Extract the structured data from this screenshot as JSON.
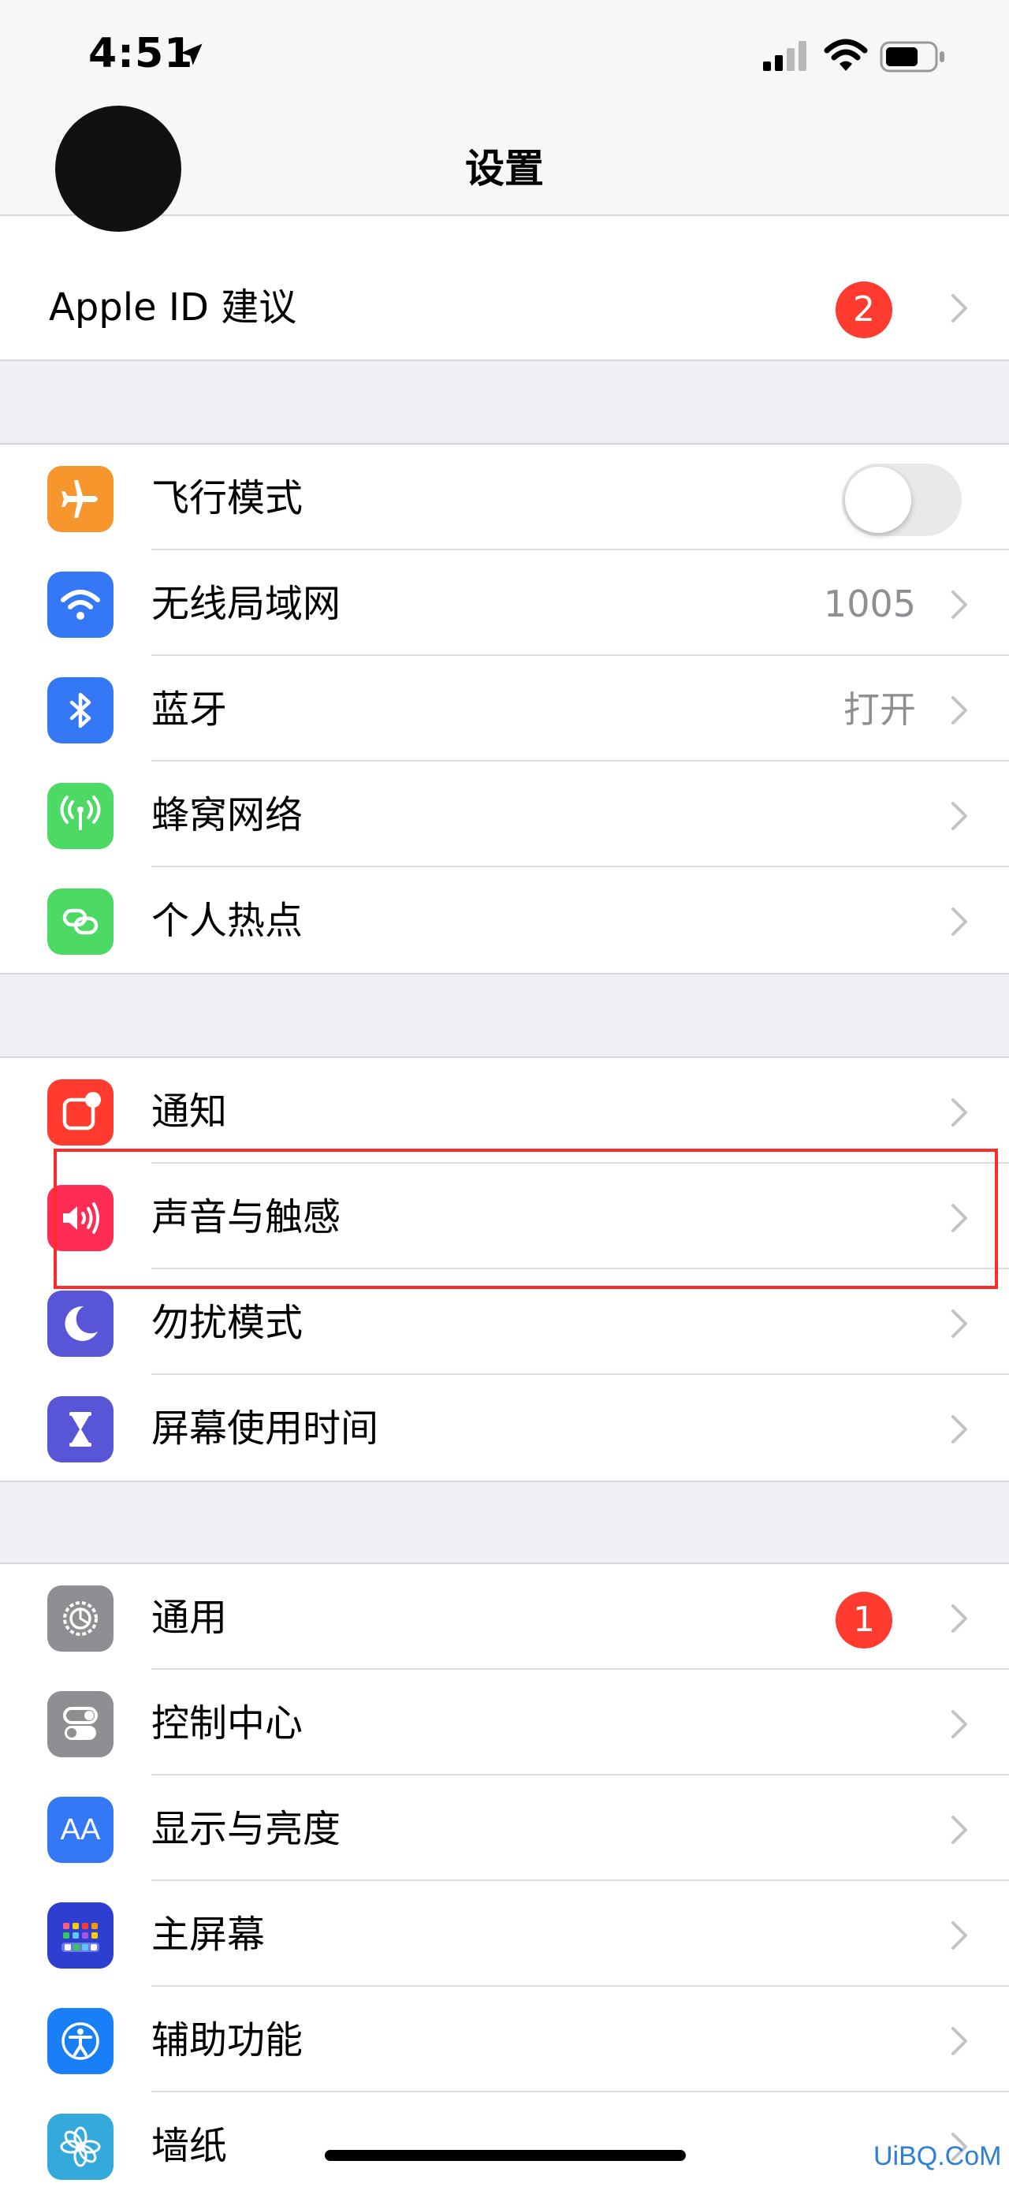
{
  "status_bar": {
    "time": "4:51"
  },
  "nav": {
    "title": "设置"
  },
  "apple_id": {
    "label": "Apple ID 建议",
    "badge": "2"
  },
  "connectivity": [
    {
      "label": "飞行模式",
      "icon": "airplane-icon",
      "color": "#f7962c",
      "toggle_on": false
    },
    {
      "label": "无线局域网",
      "icon": "wifi-icon",
      "color": "#3478f6",
      "value": "1005"
    },
    {
      "label": "蓝牙",
      "icon": "bluetooth-icon",
      "color": "#3478f6",
      "value": "打开"
    },
    {
      "label": "蜂窝网络",
      "icon": "cellular-icon",
      "color": "#4cd964"
    },
    {
      "label": "个人热点",
      "icon": "hotspot-icon",
      "color": "#4cd964"
    }
  ],
  "notifications": [
    {
      "label": "通知",
      "icon": "notifications-icon",
      "color": "#ff3b30"
    },
    {
      "label": "声音与触感",
      "icon": "speaker-icon",
      "color": "#ff2d55"
    },
    {
      "label": "勿扰模式",
      "icon": "moon-icon",
      "color": "#5856d6"
    },
    {
      "label": "屏幕使用时间",
      "icon": "hourglass-icon",
      "color": "#5856d6"
    }
  ],
  "general": [
    {
      "label": "通用",
      "icon": "gear-icon",
      "color": "#8e8e93",
      "badge": "1"
    },
    {
      "label": "控制中心",
      "icon": "toggles-icon",
      "color": "#8e8e93"
    },
    {
      "label": "显示与亮度",
      "icon": "text-size-icon",
      "color": "#3478f6",
      "glyph": "AA"
    },
    {
      "label": "主屏幕",
      "icon": "home-grid-icon",
      "color": "#2c3fd1"
    },
    {
      "label": "辅助功能",
      "icon": "accessibility-icon",
      "color": "#1a7ef6"
    },
    {
      "label": "墙纸",
      "icon": "flower-icon",
      "color": "#34aadc"
    }
  ],
  "watermark": "UiBQ.CoM"
}
